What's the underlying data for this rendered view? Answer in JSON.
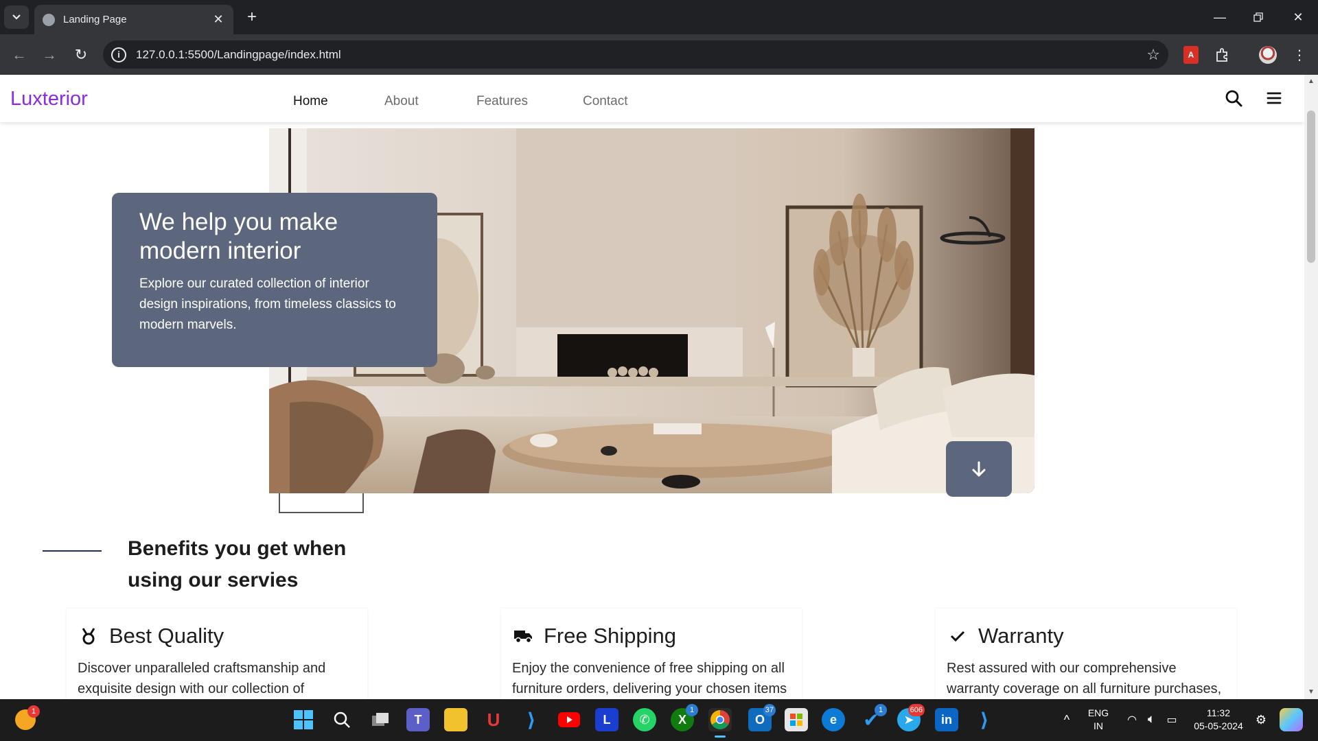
{
  "browser": {
    "tab_title": "Landing Page",
    "new_tab_label": "+",
    "url": "127.0.0.1:5500/Landingpage/index.html"
  },
  "site": {
    "brand": "Luxterior",
    "brand_color": "#8a2be2",
    "nav": [
      {
        "label": "Home",
        "active": true
      },
      {
        "label": "About"
      },
      {
        "label": "Features"
      },
      {
        "label": "Contact"
      }
    ]
  },
  "hero": {
    "heading": "We help you make modern interior",
    "text": "Explore our curated collection of interior design inspirations, from timeless classics to modern marvels.",
    "card_color": "#5c677d"
  },
  "benefits": {
    "title": "Benefits you get when using our servies",
    "items": [
      {
        "icon": "medal-icon",
        "title": "Best Quality",
        "text": "Discover unparalleled craftsmanship and exquisite design with our collection of"
      },
      {
        "icon": "truck-icon",
        "title": "Free Shipping",
        "text": "Enjoy the convenience of free shipping on all furniture orders, delivering your chosen items"
      },
      {
        "icon": "check-icon",
        "title": "Warranty",
        "text": "Rest assured with our comprehensive warranty coverage on all furniture purchases,"
      }
    ]
  },
  "taskbar": {
    "lang_line1": "ENG",
    "lang_line2": "IN",
    "time": "11:32",
    "date": "05-05-2024",
    "badges": {
      "xbox": "1",
      "outlook": "37",
      "vscode_ext": "1",
      "telegram": "606",
      "brave": "1"
    }
  }
}
